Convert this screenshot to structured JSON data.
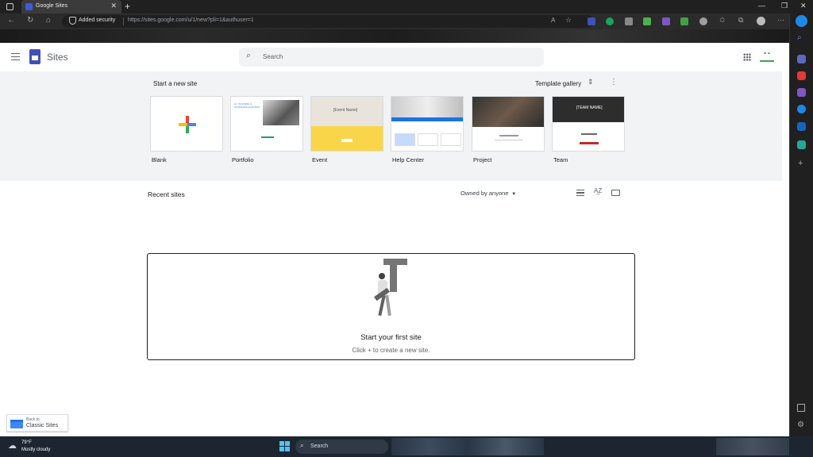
{
  "browser": {
    "tab_title": "Google Sites",
    "tab_close": "✕",
    "new_tab": "+",
    "security_label": "Added security",
    "url": "https://sites.google.com/u/1/new?pli=1&authuser=1",
    "window_controls": [
      "—",
      "❐",
      "✕"
    ],
    "extension_colors": [
      "#3f51b5",
      "#1aa260",
      "#888888",
      "#4caf50",
      "#7e57c2",
      "#43a047",
      "#9e9e9e"
    ]
  },
  "app": {
    "name": "Sites",
    "search_placeholder": "Search"
  },
  "gallery": {
    "heading": "Start a new site",
    "template_gallery_label": "Template gallery",
    "templates": [
      {
        "label": "Blank"
      },
      {
        "label": "Portfolio",
        "thumb_text": "HI, I'M MAMIE & STEPHANIE EASTERN"
      },
      {
        "label": "Event",
        "thumb_text": "[Event Name]"
      },
      {
        "label": "Help Center"
      },
      {
        "label": "Project"
      },
      {
        "label": "Team",
        "thumb_text": "[TEAM NAME]"
      }
    ]
  },
  "recent": {
    "heading": "Recent sites",
    "owner_filter": "Owned by anyone",
    "empty_title": "Start your first site",
    "empty_subtitle": "Click + to create a new site."
  },
  "classic_link": {
    "line1": "Back to",
    "line2": "Classic Sites"
  },
  "taskbar": {
    "weather_temp": "79°F",
    "weather_desc": "Mostly cloudy",
    "search_label": "Search"
  }
}
